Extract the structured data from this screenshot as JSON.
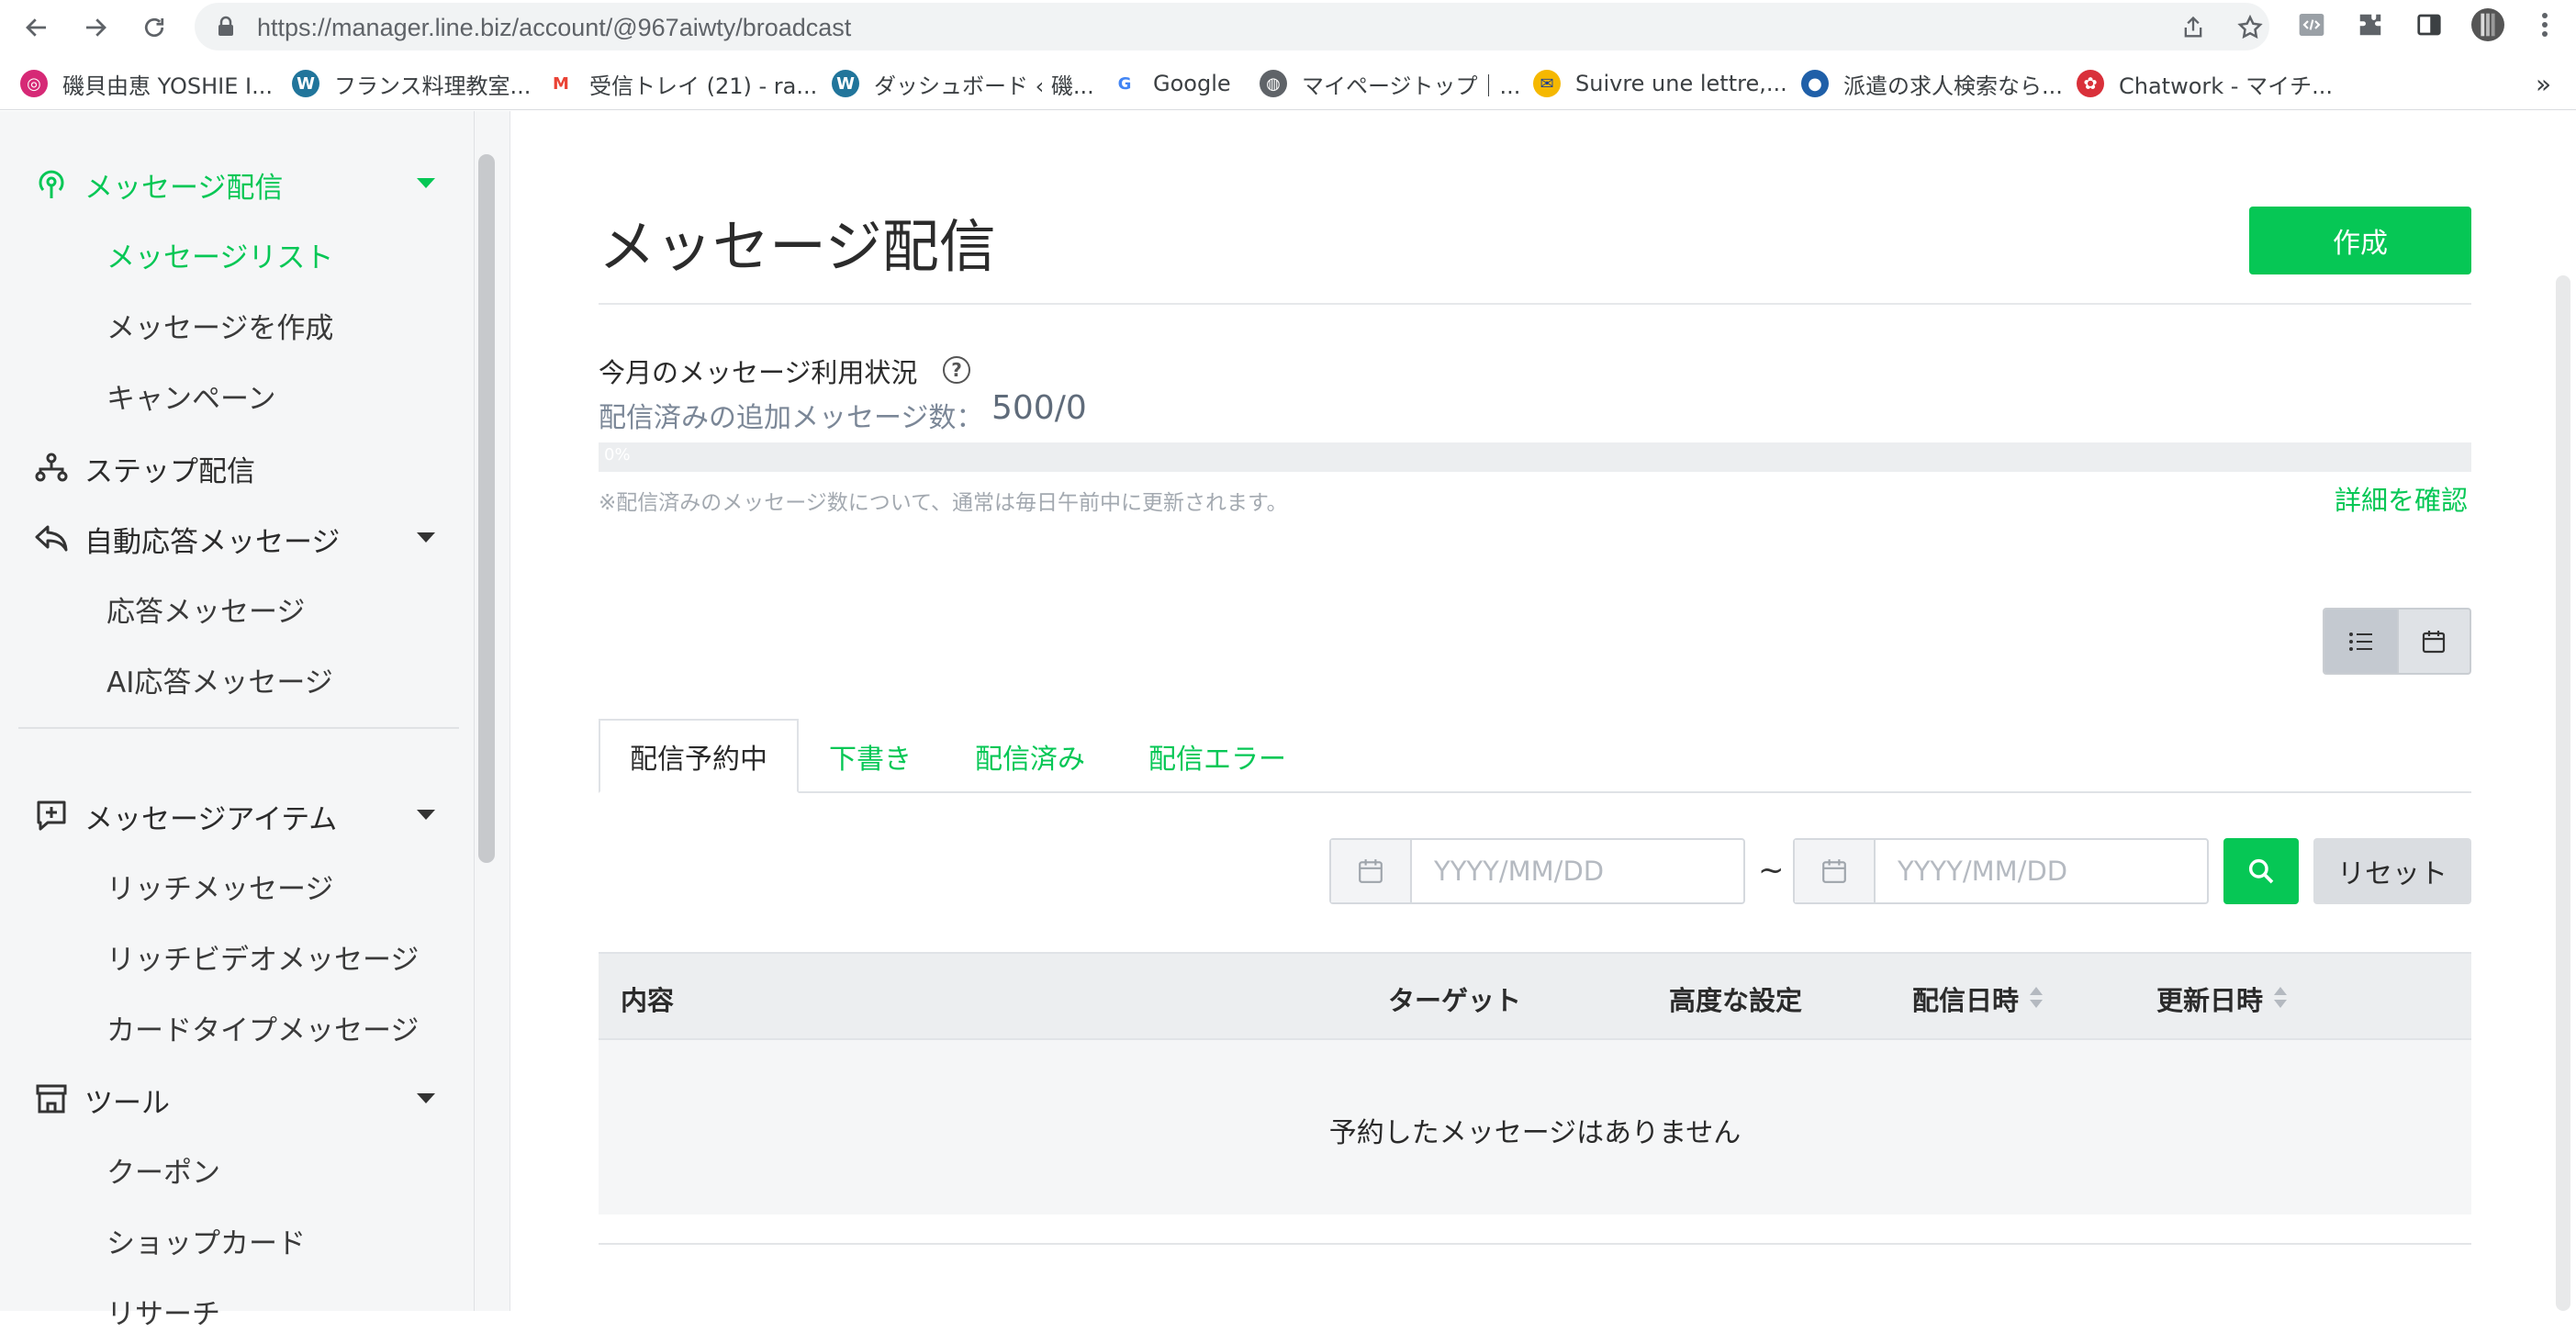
{
  "browser": {
    "url_host": "https://manager.line.biz",
    "url_path": "/account/@967aiwty/broadcast"
  },
  "bookmarks": [
    {
      "label": "磯貝由恵 YOSHIE I...",
      "icon": "instagram-icon",
      "color": "#d62976"
    },
    {
      "label": "フランス料理教室...",
      "icon": "wordpress-icon",
      "color": "#21759b"
    },
    {
      "label": "受信トレイ (21) - ra...",
      "icon": "gmail-icon",
      "color": "#ea4335"
    },
    {
      "label": "ダッシュボード ‹ 磯...",
      "icon": "wordpress-icon",
      "color": "#21759b"
    },
    {
      "label": "Google",
      "icon": "google-icon",
      "color": "#4285f4"
    },
    {
      "label": "マイページトップ｜...",
      "icon": "globe-icon",
      "color": "#5f6368"
    },
    {
      "label": "Suivre une lettre,...",
      "icon": "laposte-icon",
      "color": "#f5b800"
    },
    {
      "label": "派遣の求人検索なら...",
      "icon": "job-site-icon",
      "color": "#1f5fa8"
    },
    {
      "label": "Chatwork - マイチ...",
      "icon": "chatwork-icon",
      "color": "#d9303a"
    }
  ],
  "bookmarks_more": "»",
  "sidebar": {
    "broadcast": {
      "label": "メッセージ配信",
      "items": [
        "メッセージリスト",
        "メッセージを作成",
        "キャンペーン"
      ]
    },
    "step": {
      "label": "ステップ配信"
    },
    "autoreply": {
      "label": "自動応答メッセージ",
      "items": [
        "応答メッセージ",
        "AI応答メッセージ"
      ]
    },
    "items": {
      "label": "メッセージアイテム",
      "items": [
        "リッチメッセージ",
        "リッチビデオメッセージ",
        "カードタイプメッセージ"
      ]
    },
    "tools": {
      "label": "ツール",
      "items": [
        "クーポン",
        "ショップカード",
        "リサーチ"
      ]
    }
  },
  "main": {
    "title": "メッセージ配信",
    "create_label": "作成",
    "usage": {
      "title": "今月のメッセージ利用状況",
      "help": "?",
      "count_label": "配信済みの追加メッセージ数：",
      "count_value": "500/0",
      "progress_label": "0%",
      "progress_fraction": 0,
      "note": "※配信済みのメッセージ数について、通常は毎日午前中に更新されます。",
      "details_link": "詳細を確認"
    },
    "tabs": [
      "配信予約中",
      "下書き",
      "配信済み",
      "配信エラー"
    ],
    "filter": {
      "start_placeholder": "YYYY/MM/DD",
      "end_placeholder": "YYYY/MM/DD",
      "separator": "~",
      "reset_label": "リセット"
    },
    "table": {
      "columns": [
        "内容",
        "ターゲット",
        "高度な設定",
        "配信日時",
        "更新日時"
      ],
      "empty_message": "予約したメッセージはありません"
    }
  },
  "colors": {
    "accent": "#06c755"
  }
}
